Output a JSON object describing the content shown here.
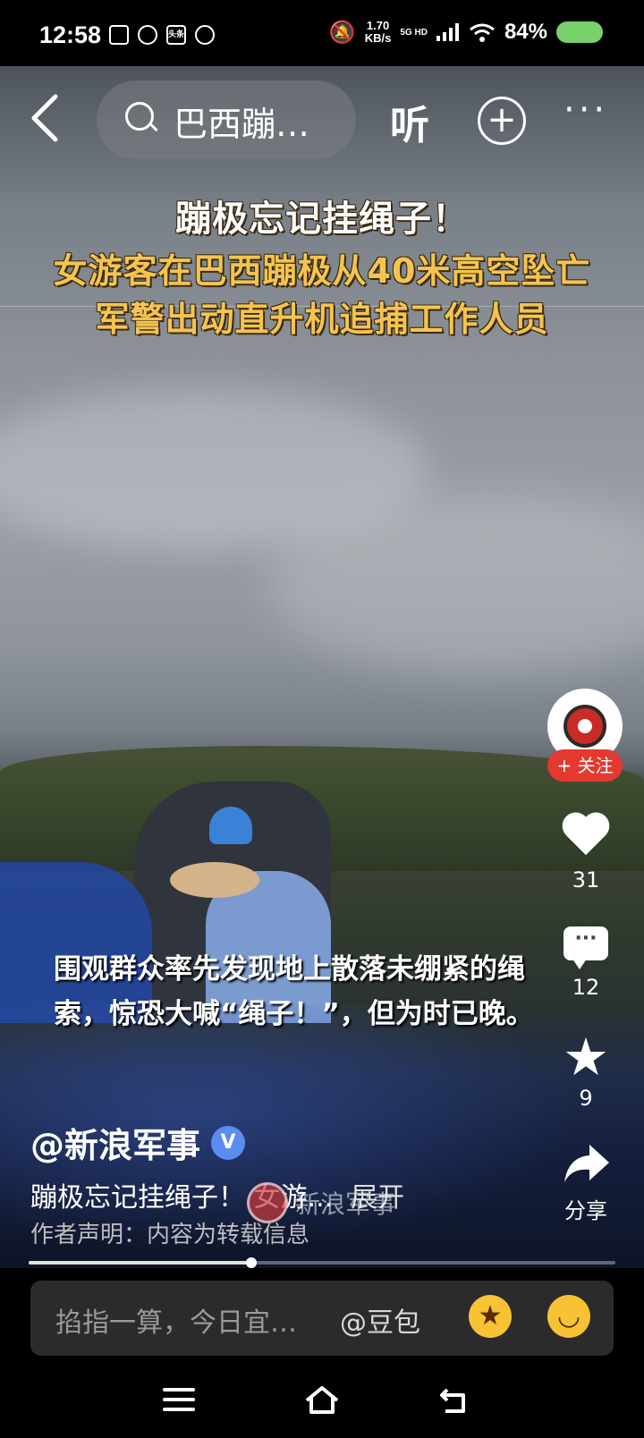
{
  "status_bar": {
    "time": "12:58",
    "mini_icon_label": "头条",
    "net_speed_value": "1.70",
    "net_speed_unit": "KB/s",
    "network_label": "5G HD",
    "battery_percent": "84%",
    "battery_color": "#78d16a"
  },
  "top_bar": {
    "search_text": "巴西蹦…",
    "listen_label": "听",
    "more_label": "···"
  },
  "video": {
    "headline_1": "蹦极忘记挂绳子！",
    "headline_2": "女游客在巴西蹦极从40米高空坠亡",
    "headline_3": "军警出动直升机追捕工作人员",
    "caption_1": "围观群众率先发现地上散落未绷紧的绳",
    "caption_2": "索，惊恐大喊“绳子！”，但为时已晚。",
    "watermark": "新浪军事"
  },
  "sidebar": {
    "follow_label": "+ 关注",
    "like_count": "31",
    "comment_count": "12",
    "favorite_count": "9",
    "share_label": "分享"
  },
  "post": {
    "author": "@新浪军事",
    "verified_badge": "V",
    "description": "蹦极忘记挂绳子！ 女游...",
    "expand_label": "展开",
    "declaration": "作者声明：内容为转载信息",
    "progress_fraction": 0.38
  },
  "input": {
    "placeholder": "掐指一算，今日宜…",
    "mention": "@豆包"
  },
  "colors": {
    "headline_yellow": "#f4c451",
    "follow_red": "#e5392f",
    "verified_blue": "#5b8df0"
  }
}
